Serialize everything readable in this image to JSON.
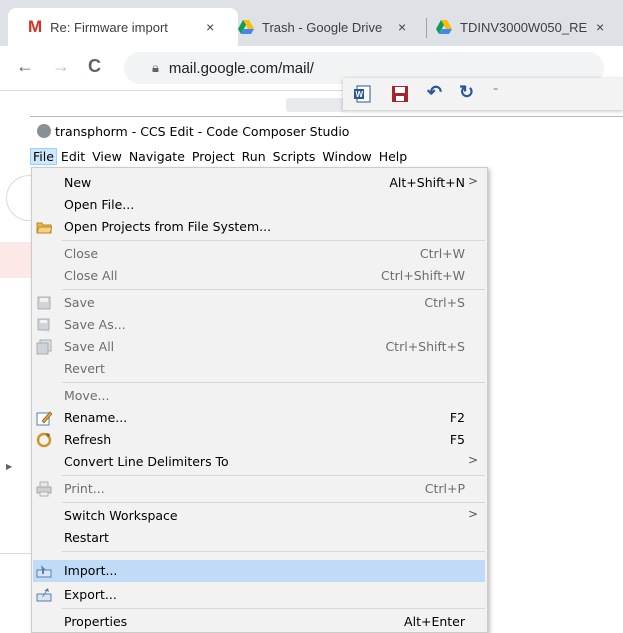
{
  "browser": {
    "tabs": [
      {
        "label": "Re: Firmware import",
        "close": "×"
      },
      {
        "label": "Trash - Google Drive",
        "close": "×"
      },
      {
        "label": "TDINV3000W050_RE",
        "close": "×"
      }
    ],
    "url": "mail.google.com/mail/",
    "nav": {
      "back": "←",
      "forward": "→",
      "reload": "C"
    }
  },
  "app": {
    "title": "transphorm - CCS Edit - Code Composer Studio",
    "menubar": [
      "File",
      "Edit",
      "View",
      "Navigate",
      "Project",
      "Run",
      "Scripts",
      "Window",
      "Help"
    ]
  },
  "file_menu": {
    "items": [
      {
        "label": "New",
        "accel": "Alt+Shift+N",
        "submenu": ">"
      },
      {
        "label": "Open File...",
        "accel": ""
      },
      {
        "label": "Open Projects from File System...",
        "accel": ""
      },
      {
        "label": "Close",
        "accel": "Ctrl+W"
      },
      {
        "label": "Close All",
        "accel": "Ctrl+Shift+W"
      },
      {
        "label": "Save",
        "accel": "Ctrl+S"
      },
      {
        "label": "Save As...",
        "accel": ""
      },
      {
        "label": "Save All",
        "accel": "Ctrl+Shift+S"
      },
      {
        "label": "Revert",
        "accel": ""
      },
      {
        "label": "Move...",
        "accel": ""
      },
      {
        "label": "Rename...",
        "accel": "F2"
      },
      {
        "label": "Refresh",
        "accel": "F5"
      },
      {
        "label": "Convert Line Delimiters To",
        "accel": "",
        "submenu": ">"
      },
      {
        "label": "Print...",
        "accel": "Ctrl+P"
      },
      {
        "label": "Switch Workspace",
        "accel": "",
        "submenu": ">"
      },
      {
        "label": "Restart",
        "accel": ""
      },
      {
        "label": "Import...",
        "accel": ""
      },
      {
        "label": "Export...",
        "accel": ""
      },
      {
        "label": "Properties",
        "accel": "Alt+Enter"
      }
    ]
  },
  "colors": {
    "highlight": "#bfdbf7",
    "menu_bg": "#f2f2f2",
    "gmail_red": "#d93025"
  }
}
